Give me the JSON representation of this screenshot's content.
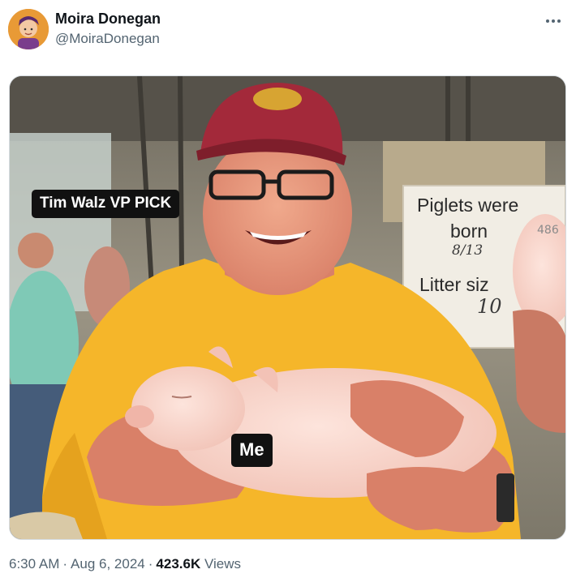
{
  "tweet": {
    "author": {
      "name": "Moira Donegan",
      "handle": "@MoiraDonegan",
      "avatar_icon": "illustrated-portrait-avatar"
    },
    "more_icon": "more-horizontal-icon",
    "image": {
      "caption_top": "Tim Walz VP PICK",
      "caption_me": "Me",
      "sign": {
        "line1": "Piglets were",
        "line2": "born",
        "born_value": "8/13",
        "line3": "Litter siz",
        "litter_value": "10",
        "pen_number": "486"
      }
    },
    "meta": {
      "time": "6:30 AM",
      "separator": "·",
      "date": "Aug 6, 2024",
      "views_count": "423.6K",
      "views_label": "Views"
    }
  },
  "colors": {
    "text_primary": "#0f1419",
    "text_secondary": "#536471",
    "caption_bg": "#111111"
  }
}
